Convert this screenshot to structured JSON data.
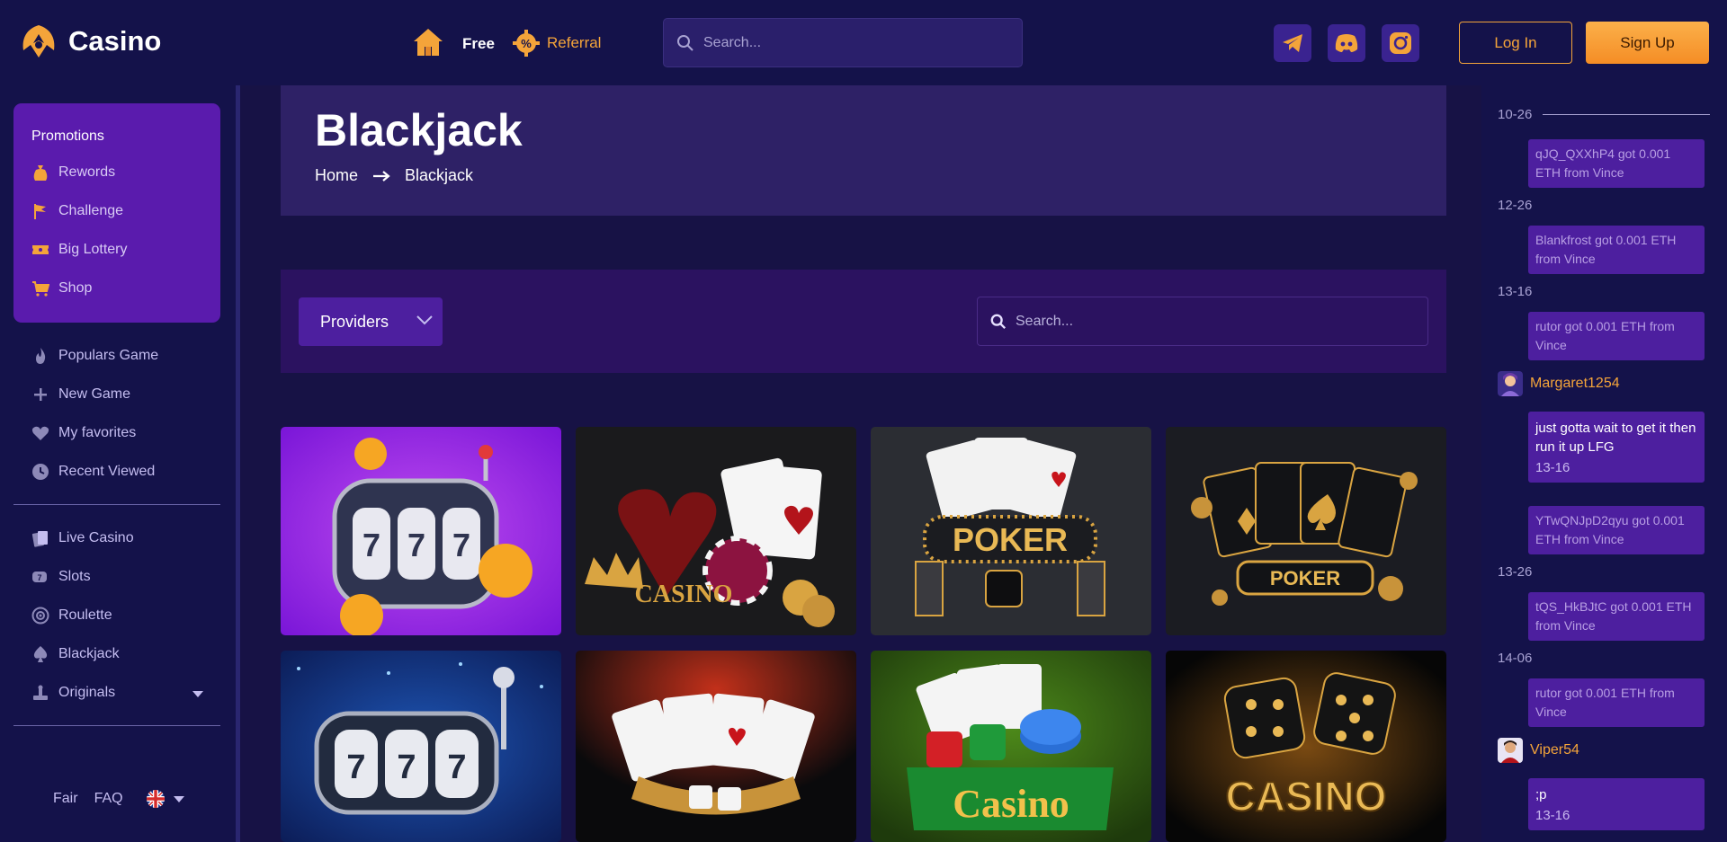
{
  "header": {
    "logo_text": "Casino",
    "nav_free": "Free",
    "nav_referral": "Referral",
    "search_placeholder": "Search...",
    "login_label": "Log In",
    "signup_label": "Sign Up",
    "social_icons": [
      "telegram-icon",
      "discord-icon",
      "instagram-icon"
    ],
    "accent_color": "#f4a43a"
  },
  "sidebar": {
    "promotions_title": "Promotions",
    "promo_items": [
      {
        "label": "Rewords",
        "icon": "reward-bag-icon"
      },
      {
        "label": "Challenge",
        "icon": "challenge-flag-icon"
      },
      {
        "label": "Big Lottery",
        "icon": "ticket-icon"
      },
      {
        "label": "Shop",
        "icon": "cart-icon"
      }
    ],
    "game_items": [
      {
        "label": "Populars Game",
        "icon": "flame-icon"
      },
      {
        "label": "New Game",
        "icon": "plus-icon"
      },
      {
        "label": "My favorites",
        "icon": "heart-icon"
      },
      {
        "label": "Recent Viewed",
        "icon": "clock-icon"
      }
    ],
    "category_items": [
      {
        "label": "Live Casino",
        "icon": "cards-icon"
      },
      {
        "label": "Slots",
        "icon": "slot-icon"
      },
      {
        "label": "Roulette",
        "icon": "roulette-icon"
      },
      {
        "label": "Blackjack",
        "icon": "spade-icon"
      },
      {
        "label": "Originals",
        "icon": "originals-icon"
      }
    ],
    "footer": {
      "fair": "Fair",
      "faq": "FAQ",
      "language_icon": "uk-flag-icon"
    }
  },
  "main": {
    "title": "Blackjack",
    "breadcrumb": [
      "Home",
      "Blackjack"
    ],
    "providers_label": "Providers",
    "search_placeholder": "Search..."
  },
  "activity": {
    "feed": [
      {
        "type": "date",
        "text": "10-26"
      },
      {
        "type": "event",
        "text": "qJQ_QXXhP4 got 0.001 ETH from Vince"
      },
      {
        "type": "date",
        "text": "12-26"
      },
      {
        "type": "event",
        "text": "Blankfrost got 0.001 ETH from Vince"
      },
      {
        "type": "date",
        "text": "13-16"
      },
      {
        "type": "event",
        "text": "rutor got 0.001 ETH from Vince"
      },
      {
        "type": "user",
        "text": "Margaret1254"
      },
      {
        "type": "chat",
        "text": "just gotta wait to get it then run it up LFG",
        "time": "13-16"
      },
      {
        "type": "event",
        "text": "YTwQNJpD2qyu got 0.001 ETH from Vince"
      },
      {
        "type": "date",
        "text": "13-26"
      },
      {
        "type": "event",
        "text": "tQS_HkBJtC got 0.001 ETH from Vince"
      },
      {
        "type": "date",
        "text": "14-06"
      },
      {
        "type": "event",
        "text": "rutor got 0.001 ETH from Vince"
      },
      {
        "type": "user",
        "text": "Viper54"
      },
      {
        "type": "chat",
        "text": ";p",
        "time": "13-16"
      }
    ]
  }
}
